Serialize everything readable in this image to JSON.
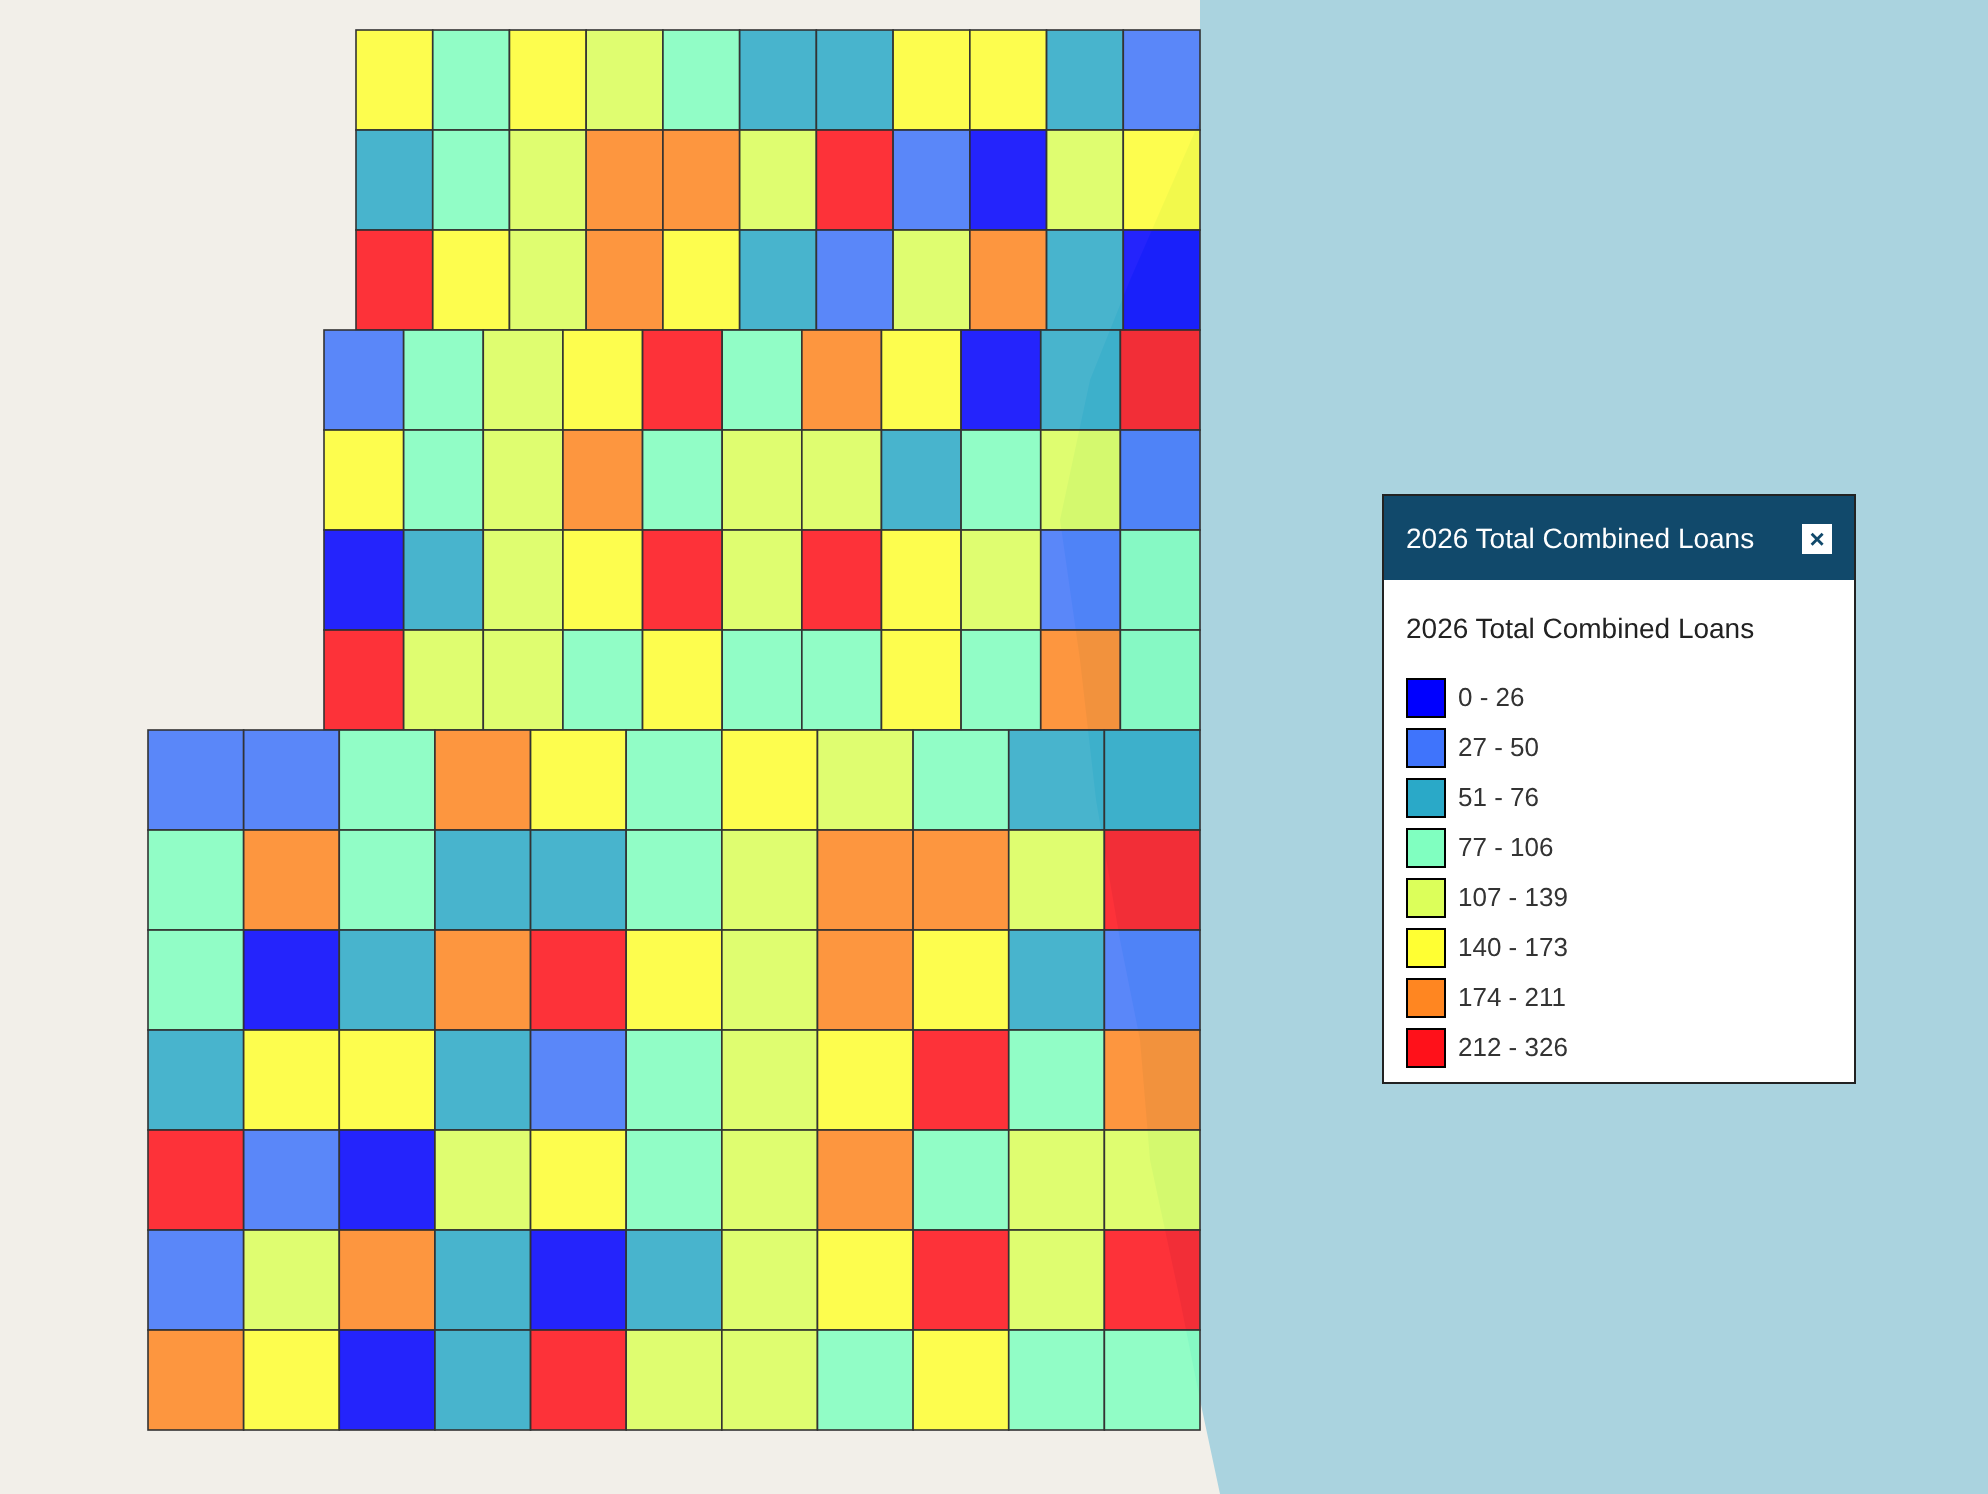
{
  "legend_panel": {
    "title": "2026 Total Combined Loans",
    "close_label": "×",
    "heading": "2026 Total Combined Loans",
    "items": [
      {
        "label": "0 - 26",
        "color": "#0000ff"
      },
      {
        "label": "27 - 50",
        "color": "#3f74fc"
      },
      {
        "label": "51 - 76",
        "color": "#2aa9c8"
      },
      {
        "label": "77 - 106",
        "color": "#80ffc0"
      },
      {
        "label": "107 - 139",
        "color": "#dcff5a"
      },
      {
        "label": "140 - 173",
        "color": "#ffff33"
      },
      {
        "label": "174 - 211",
        "color": "#ff8621"
      },
      {
        "label": "212 - 326",
        "color": "#ff111a"
      }
    ]
  }
}
